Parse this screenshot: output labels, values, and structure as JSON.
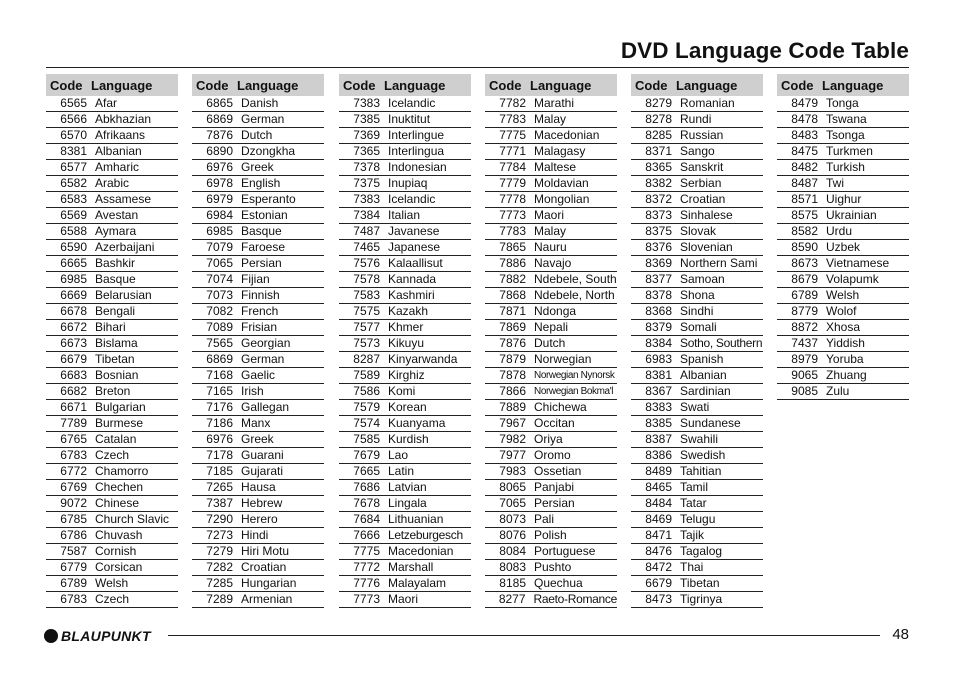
{
  "page": {
    "title": "DVD Language Code Table",
    "page_number": "48",
    "brand": "BLAUPUNKT"
  },
  "table_header": {
    "code": "Code",
    "language": "Language"
  },
  "columns": [
    {
      "rows": [
        [
          "6565",
          "Afar"
        ],
        [
          "6566",
          "Abkhazian"
        ],
        [
          "6570",
          "Afrikaans"
        ],
        [
          "8381",
          "Albanian"
        ],
        [
          "6577",
          "Amharic"
        ],
        [
          "6582",
          "Arabic"
        ],
        [
          "6583",
          "Assamese"
        ],
        [
          "6569",
          "Avestan"
        ],
        [
          "6588",
          "Aymara"
        ],
        [
          "6590",
          "Azerbaijani"
        ],
        [
          "6665",
          "Bashkir"
        ],
        [
          "6985",
          "Basque"
        ],
        [
          "6669",
          "Belarusian"
        ],
        [
          "6678",
          "Bengali"
        ],
        [
          "6672",
          "Bihari"
        ],
        [
          "6673",
          "Bislama"
        ],
        [
          "6679",
          "Tibetan"
        ],
        [
          "6683",
          "Bosnian"
        ],
        [
          "6682",
          "Breton"
        ],
        [
          "6671",
          "Bulgarian"
        ],
        [
          "7789",
          "Burmese"
        ],
        [
          "6765",
          "Catalan"
        ],
        [
          "6783",
          "Czech"
        ],
        [
          "6772",
          "Chamorro"
        ],
        [
          "6769",
          "Chechen"
        ],
        [
          "9072",
          "Chinese"
        ],
        [
          "6785",
          "Church Slavic"
        ],
        [
          "6786",
          "Chuvash"
        ],
        [
          "7587",
          "Cornish"
        ],
        [
          "6779",
          "Corsican"
        ],
        [
          "6789",
          "Welsh"
        ],
        [
          "6783",
          "Czech"
        ]
      ]
    },
    {
      "rows": [
        [
          "6865",
          "Danish"
        ],
        [
          "6869",
          "German"
        ],
        [
          "7876",
          "Dutch"
        ],
        [
          "6890",
          "Dzongkha"
        ],
        [
          "6976",
          "Greek"
        ],
        [
          "6978",
          "English"
        ],
        [
          "6979",
          "Esperanto"
        ],
        [
          "6984",
          "Estonian"
        ],
        [
          "6985",
          "Basque"
        ],
        [
          "7079",
          "Faroese"
        ],
        [
          "7065",
          "Persian"
        ],
        [
          "7074",
          "Fijian"
        ],
        [
          "7073",
          "Finnish"
        ],
        [
          "7082",
          "French"
        ],
        [
          "7089",
          "Frisian"
        ],
        [
          "7565",
          "Georgian"
        ],
        [
          "6869",
          "German"
        ],
        [
          "7168",
          "Gaelic"
        ],
        [
          "7165",
          "Irish"
        ],
        [
          "7176",
          "Gallegan"
        ],
        [
          "7186",
          "Manx"
        ],
        [
          "6976",
          "Greek"
        ],
        [
          "7178",
          "Guarani"
        ],
        [
          "7185",
          "Gujarati"
        ],
        [
          "7265",
          "Hausa"
        ],
        [
          "7387",
          "Hebrew"
        ],
        [
          "7290",
          "Herero"
        ],
        [
          "7273",
          "Hindi"
        ],
        [
          "7279",
          "Hiri Motu"
        ],
        [
          "7282",
          "Croatian"
        ],
        [
          "7285",
          "Hungarian"
        ],
        [
          "7289",
          "Armenian"
        ]
      ]
    },
    {
      "rows": [
        [
          "7383",
          "Icelandic"
        ],
        [
          "7385",
          "Inuktitut"
        ],
        [
          "7369",
          "Interlingue"
        ],
        [
          "7365",
          "Interlingua"
        ],
        [
          "7378",
          "Indonesian"
        ],
        [
          "7375",
          "Inupiaq"
        ],
        [
          "7383",
          "Icelandic"
        ],
        [
          "7384",
          "Italian"
        ],
        [
          "7487",
          "Javanese"
        ],
        [
          "7465",
          "Japanese"
        ],
        [
          "7576",
          "Kalaallisut"
        ],
        [
          "7578",
          "Kannada"
        ],
        [
          "7583",
          "Kashmiri"
        ],
        [
          "7575",
          "Kazakh"
        ],
        [
          "7577",
          "Khmer"
        ],
        [
          "7573",
          "Kikuyu"
        ],
        [
          "8287",
          "Kinyarwanda"
        ],
        [
          "7589",
          "Kirghiz"
        ],
        [
          "7586",
          "Komi"
        ],
        [
          "7579",
          "Korean"
        ],
        [
          "7574",
          "Kuanyama"
        ],
        [
          "7585",
          "Kurdish"
        ],
        [
          "7679",
          "Lao"
        ],
        [
          "7665",
          "Latin"
        ],
        [
          "7686",
          "Latvian"
        ],
        [
          "7678",
          "Lingala"
        ],
        [
          "7684",
          "Lithuanian"
        ],
        [
          "7666",
          "Letzeburgesch"
        ],
        [
          "7775",
          "Macedonian"
        ],
        [
          "7772",
          "Marshall"
        ],
        [
          "7776",
          "Malayalam"
        ],
        [
          "7773",
          "Maori"
        ]
      ]
    },
    {
      "rows": [
        [
          "7782",
          "Marathi"
        ],
        [
          "7783",
          "Malay"
        ],
        [
          "7775",
          "Macedonian"
        ],
        [
          "7771",
          "Malagasy"
        ],
        [
          "7784",
          "Maltese"
        ],
        [
          "7779",
          "Moldavian"
        ],
        [
          "7778",
          "Mongolian"
        ],
        [
          "7773",
          "Maori"
        ],
        [
          "7783",
          "Malay"
        ],
        [
          "7865",
          "Nauru"
        ],
        [
          "7886",
          "Navajo"
        ],
        [
          "7882",
          "Ndebele, South"
        ],
        [
          "7868",
          "Ndebele, North"
        ],
        [
          "7871",
          "Ndonga"
        ],
        [
          "7869",
          "Nepali"
        ],
        [
          "7876",
          "Dutch"
        ],
        [
          "7879",
          "Norwegian"
        ],
        [
          "7878",
          "Norwegian Nynorsk"
        ],
        [
          "7866",
          "Norwegian Bokma'l"
        ],
        [
          "7889",
          "Chichewa"
        ],
        [
          "7967",
          "Occitan"
        ],
        [
          "7982",
          "Oriya"
        ],
        [
          "7977",
          "Oromo"
        ],
        [
          "7983",
          "Ossetian"
        ],
        [
          "8065",
          "Panjabi"
        ],
        [
          "7065",
          "Persian"
        ],
        [
          "8073",
          "Pali"
        ],
        [
          "8076",
          "Polish"
        ],
        [
          "8084",
          "Portuguese"
        ],
        [
          "8083",
          "Pushto"
        ],
        [
          "8185",
          "Quechua"
        ],
        [
          "8277",
          "Raeto-Romance"
        ]
      ]
    },
    {
      "rows": [
        [
          "8279",
          "Romanian"
        ],
        [
          "8278",
          "Rundi"
        ],
        [
          "8285",
          "Russian"
        ],
        [
          "8371",
          "Sango"
        ],
        [
          "8365",
          "Sanskrit"
        ],
        [
          "8382",
          "Serbian"
        ],
        [
          "8372",
          "Croatian"
        ],
        [
          "8373",
          "Sinhalese"
        ],
        [
          "8375",
          "Slovak"
        ],
        [
          "8376",
          "Slovenian"
        ],
        [
          "8369",
          "Northern Sami"
        ],
        [
          "8377",
          "Samoan"
        ],
        [
          "8378",
          "Shona"
        ],
        [
          "8368",
          "Sindhi"
        ],
        [
          "8379",
          "Somali"
        ],
        [
          "8384",
          "Sotho, Southern"
        ],
        [
          "6983",
          "Spanish"
        ],
        [
          "8381",
          "Albanian"
        ],
        [
          "8367",
          "Sardinian"
        ],
        [
          "8383",
          "Swati"
        ],
        [
          "8385",
          "Sundanese"
        ],
        [
          "8387",
          "Swahili"
        ],
        [
          "8386",
          "Swedish"
        ],
        [
          "8489",
          "Tahitian"
        ],
        [
          "8465",
          "Tamil"
        ],
        [
          "8484",
          "Tatar"
        ],
        [
          "8469",
          "Telugu"
        ],
        [
          "8471",
          "Tajik"
        ],
        [
          "8476",
          "Tagalog"
        ],
        [
          "8472",
          "Thai"
        ],
        [
          "6679",
          "Tibetan"
        ],
        [
          "8473",
          "Tigrinya"
        ]
      ]
    },
    {
      "rows": [
        [
          "8479",
          "Tonga"
        ],
        [
          "8478",
          "Tswana"
        ],
        [
          "8483",
          "Tsonga"
        ],
        [
          "8475",
          "Turkmen"
        ],
        [
          "8482",
          "Turkish"
        ],
        [
          "8487",
          "Twi"
        ],
        [
          "8571",
          "Uighur"
        ],
        [
          "8575",
          "Ukrainian"
        ],
        [
          "8582",
          "Urdu"
        ],
        [
          "8590",
          "Uzbek"
        ],
        [
          "8673",
          "Vietnamese"
        ],
        [
          "8679",
          "Volapumk"
        ],
        [
          "6789",
          "Welsh"
        ],
        [
          "8779",
          "Wolof"
        ],
        [
          "8872",
          "Xhosa"
        ],
        [
          "7437",
          "Yiddish"
        ],
        [
          "8979",
          "Yoruba"
        ],
        [
          "9065",
          "Zhuang"
        ],
        [
          "9085",
          "Zulu"
        ]
      ]
    }
  ]
}
